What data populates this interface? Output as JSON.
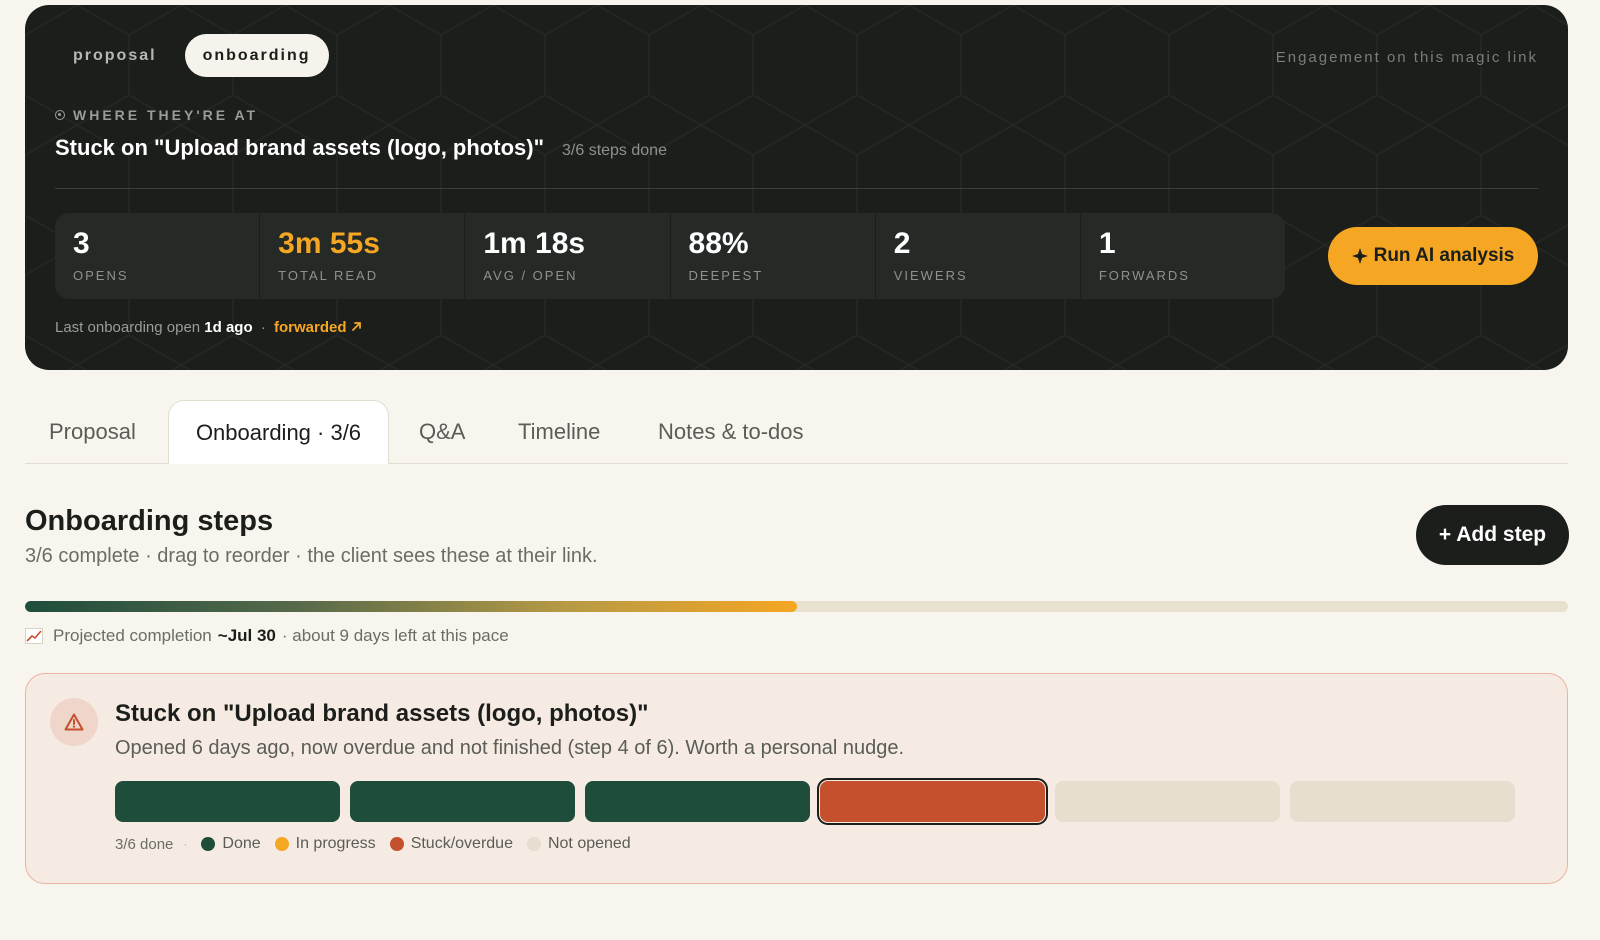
{
  "hero": {
    "segment_tabs": [
      {
        "label": "proposal",
        "active": false
      },
      {
        "label": "onboarding",
        "active": true
      }
    ],
    "engagement_label": "Engagement on this magic link",
    "where_label": "WHERE THEY'RE AT",
    "stuck_title": "Stuck on \"Upload brand assets (logo, photos)\"",
    "steps_done": "3/6 steps done",
    "stats": [
      {
        "value": "3",
        "label": "OPENS",
        "accent": false
      },
      {
        "value": "3m 55s",
        "label": "TOTAL READ",
        "accent": true
      },
      {
        "value": "1m 18s",
        "label": "AVG / OPEN",
        "accent": false
      },
      {
        "value": "88%",
        "label": "DEEPEST",
        "accent": false
      },
      {
        "value": "2",
        "label": "VIEWERS",
        "accent": false
      },
      {
        "value": "1",
        "label": "FORWARDS",
        "accent": false
      }
    ],
    "run_ai_label": "Run AI analysis",
    "last_open_prefix": "Last onboarding open",
    "last_open_when": "1d ago",
    "separator": "·",
    "forwarded_label": "forwarded",
    "accent_color": "#f5a623"
  },
  "tabs": [
    {
      "label": "Proposal",
      "active": false
    },
    {
      "label": "Onboarding · 3/6",
      "active": true
    },
    {
      "label": "Q&A",
      "active": false
    },
    {
      "label": "Timeline",
      "active": false
    },
    {
      "label": "Notes & to-dos",
      "active": false
    }
  ],
  "steps": {
    "title": "Onboarding steps",
    "subtitle": "3/6 complete · drag to reorder · the client sees these at their link.",
    "add_step_label": "+ Add step",
    "progress_fraction": 0.5,
    "projected_prefix": "Projected completion",
    "projected_date": "~Jul 30",
    "projected_suffix": "· about 9 days left at this pace"
  },
  "alert": {
    "title": "Stuck on \"Upload brand assets (logo, photos)\"",
    "description": "Opened 6 days ago, now overdue and not finished (step 4 of 6). Worth a personal nudge.",
    "segments": [
      "done",
      "done",
      "done",
      "stuck",
      "not-opened",
      "not-opened"
    ],
    "done_count": "3/6 done",
    "separator": "·",
    "legend": [
      {
        "label": "Done",
        "color": "#1f4d3c"
      },
      {
        "label": "In progress",
        "color": "#f5a623"
      },
      {
        "label": "Stuck/overdue",
        "color": "#c4502d"
      },
      {
        "label": "Not opened",
        "color": "#e6dfcf"
      }
    ]
  }
}
